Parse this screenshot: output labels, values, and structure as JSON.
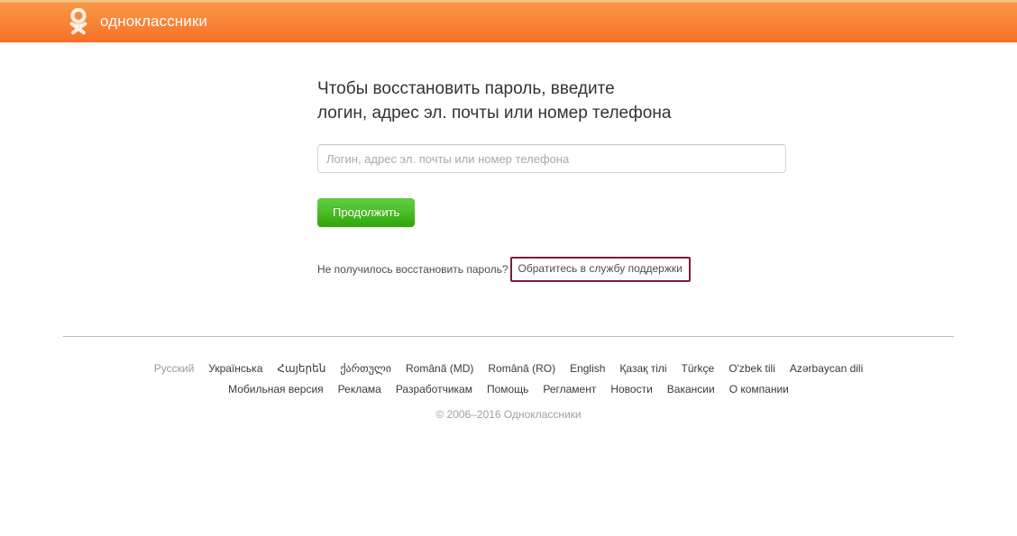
{
  "header": {
    "logo_icon": "ok-logo-icon",
    "brand": "одноклассники",
    "brand_color": "#ffffff",
    "background_color": "#f8893c"
  },
  "main": {
    "headline_line1": "Чтобы восстановить пароль, введите",
    "headline_line2": "логин, адрес эл. почты или номер телефона",
    "input": {
      "value": "",
      "placeholder": "Логин, адрес эл. почты или номер телефона"
    },
    "submit_label": "Продолжить",
    "submit_color": "#4fbf2c",
    "support": {
      "question": "Не получилось восстановить пароль?",
      "link_label": "Обратитесь в службу поддержки",
      "highlight_color": "#7b1d3c"
    }
  },
  "footer": {
    "languages": [
      {
        "label": "Русский",
        "current": true
      },
      {
        "label": "Українська",
        "current": false
      },
      {
        "label": "Հայերեն",
        "current": false
      },
      {
        "label": "ქართული",
        "current": false
      },
      {
        "label": "Română (MD)",
        "current": false
      },
      {
        "label": "Română (RO)",
        "current": false
      },
      {
        "label": "English",
        "current": false
      },
      {
        "label": "Қазақ тілі",
        "current": false
      },
      {
        "label": "Türkçe",
        "current": false
      },
      {
        "label": "O'zbek tili",
        "current": false
      },
      {
        "label": "Azərbaycan dili",
        "current": false
      }
    ],
    "links": [
      {
        "label": "Мобильная версия"
      },
      {
        "label": "Реклама"
      },
      {
        "label": "Разработчикам"
      },
      {
        "label": "Помощь"
      },
      {
        "label": "Регламент"
      },
      {
        "label": "Новости"
      },
      {
        "label": "Вакансии"
      },
      {
        "label": "О компании"
      }
    ],
    "copyright": "© 2006–2016 Одноклассники"
  }
}
